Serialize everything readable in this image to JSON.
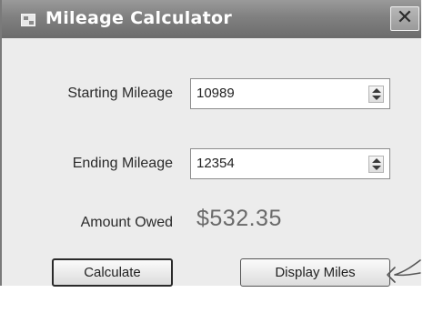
{
  "window": {
    "title": "Mileage Calculator",
    "close_glyph": "✕"
  },
  "fields": {
    "starting": {
      "label": "Starting Mileage",
      "value": "10989"
    },
    "ending": {
      "label": "Ending Mileage",
      "value": "12354"
    }
  },
  "amount": {
    "label": "Amount Owed",
    "value": "$532.35"
  },
  "buttons": {
    "calculate": "Calculate",
    "display_miles": "Display Miles"
  },
  "icons": {
    "app": "application-window-icon",
    "close": "close-icon",
    "spin": "up-down-arrows-icon",
    "annotation": "hand-drawn-arrow-icon"
  }
}
